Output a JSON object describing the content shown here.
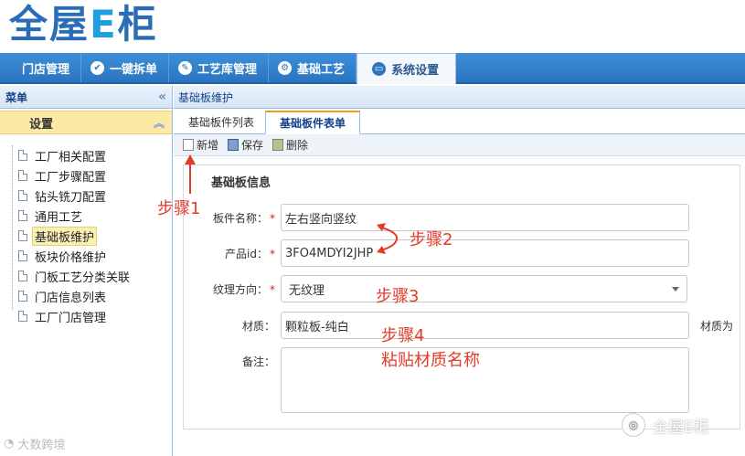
{
  "app": {
    "logo_text_a": "全屋",
    "logo_text_e": "E",
    "logo_text_b": "柜"
  },
  "topnav": [
    {
      "label": "门店管理",
      "icon": "none"
    },
    {
      "label": "一键拆单",
      "icon": "check-circle-icon"
    },
    {
      "label": "工艺库管理",
      "icon": "wrench-icon"
    },
    {
      "label": "基础工艺",
      "icon": "gear-icon"
    },
    {
      "label": "系统设置",
      "icon": "monitor-icon",
      "active": true
    }
  ],
  "sidebar": {
    "title": "菜单",
    "collapse_glyph": "«",
    "group": "设置",
    "group_glyph": "︽",
    "items": [
      {
        "label": "工厂相关配置"
      },
      {
        "label": "工厂步骤配置"
      },
      {
        "label": "钻头铣刀配置"
      },
      {
        "label": "通用工艺"
      },
      {
        "label": "基础板维护",
        "selected": true
      },
      {
        "label": "板块价格维护"
      },
      {
        "label": "门板工艺分类关联"
      },
      {
        "label": "门店信息列表"
      },
      {
        "label": "工厂门店管理"
      }
    ]
  },
  "main": {
    "breadcrumb": "基础板维护",
    "tabs": [
      {
        "label": "基础板件列表"
      },
      {
        "label": "基础板件表单",
        "active": true
      }
    ],
    "toolbar": {
      "new_label": "新增",
      "save_label": "保存",
      "delete_label": "删除"
    },
    "form": {
      "title": "基础板信息",
      "name_label": "板件名称：",
      "name_value": "左右竖向竖纹",
      "product_label": "产品id：",
      "product_value": "3FO4MDYI2JHP",
      "grain_label": "纹理方向：",
      "grain_value": "无纹理",
      "material_label": "材质：",
      "material_value": "颗粒板-纯白",
      "material_note": "材质为",
      "remark_label": "备注：",
      "remark_value": "",
      "required_mark": "*"
    }
  },
  "annotations": {
    "step1": "步骤1",
    "step2": "步骤2",
    "step3": "步骤3",
    "step4": "步骤4",
    "step4_note": "粘贴材质名称",
    "color": "#e53a2a"
  },
  "watermarks": {
    "left": "大数跨境",
    "right": "全屋E柜"
  }
}
